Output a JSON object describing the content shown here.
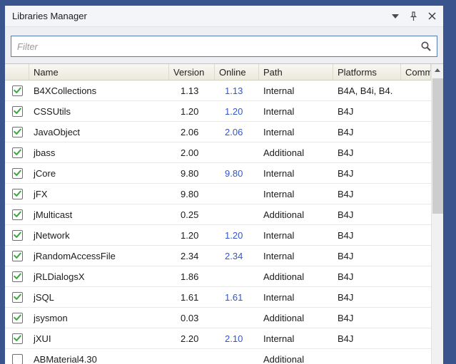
{
  "panel": {
    "title": "Libraries Manager"
  },
  "icons": {
    "titlebar": [
      "chevron-down-icon",
      "pin-icon",
      "close-icon"
    ],
    "filter": "magnifier-icon"
  },
  "filter": {
    "placeholder": "Filter",
    "value": ""
  },
  "table": {
    "columns": [
      "",
      "Name",
      "Version",
      "Online",
      "Path",
      "Platforms",
      "Comm"
    ],
    "rows": [
      {
        "checked": true,
        "name": "B4XCollections",
        "version": "1.13",
        "online": "1.13",
        "path": "Internal",
        "platforms": "B4A, B4i, B4."
      },
      {
        "checked": true,
        "name": "CSSUtils",
        "version": "1.20",
        "online": "1.20",
        "path": "Internal",
        "platforms": "B4J"
      },
      {
        "checked": true,
        "name": "JavaObject",
        "version": "2.06",
        "online": "2.06",
        "path": "Internal",
        "platforms": "B4J"
      },
      {
        "checked": true,
        "name": "jbass",
        "version": "2.00",
        "online": "",
        "path": "Additional",
        "platforms": "B4J"
      },
      {
        "checked": true,
        "name": "jCore",
        "version": "9.80",
        "online": "9.80",
        "path": "Internal",
        "platforms": "B4J"
      },
      {
        "checked": true,
        "name": "jFX",
        "version": "9.80",
        "online": "",
        "path": "Internal",
        "platforms": "B4J"
      },
      {
        "checked": true,
        "name": "jMulticast",
        "version": "0.25",
        "online": "",
        "path": "Additional",
        "platforms": "B4J"
      },
      {
        "checked": true,
        "name": "jNetwork",
        "version": "1.20",
        "online": "1.20",
        "path": "Internal",
        "platforms": "B4J"
      },
      {
        "checked": true,
        "name": "jRandomAccessFile",
        "version": "2.34",
        "online": "2.34",
        "path": "Internal",
        "platforms": "B4J"
      },
      {
        "checked": true,
        "name": "jRLDialogsX",
        "version": "1.86",
        "online": "",
        "path": "Additional",
        "platforms": "B4J"
      },
      {
        "checked": true,
        "name": "jSQL",
        "version": "1.61",
        "online": "1.61",
        "path": "Internal",
        "platforms": "B4J"
      },
      {
        "checked": true,
        "name": "jsysmon",
        "version": "0.03",
        "online": "",
        "path": "Additional",
        "platforms": "B4J"
      },
      {
        "checked": true,
        "name": "jXUI",
        "version": "2.20",
        "online": "2.10",
        "path": "Internal",
        "platforms": "B4J"
      },
      {
        "checked": false,
        "name": "ABMaterial4.30",
        "version": "",
        "online": "",
        "path": "Additional",
        "platforms": ""
      }
    ]
  },
  "colors": {
    "frame": "#3A548E",
    "link": "#3355C8",
    "check": "#3FA53F",
    "filter_border": "#567CB0"
  }
}
